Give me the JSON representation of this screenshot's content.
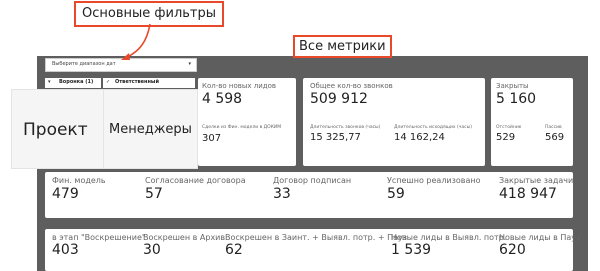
{
  "annotations": {
    "filters_label": "Основные фильтры",
    "metrics_label": "Все метрики",
    "project_label": "Проект",
    "managers_label": "Менеджеры"
  },
  "filters": {
    "date_range_placeholder": "Выберите диапазон дат",
    "funnel_filter": "Воронка (1)",
    "responsible_filter": "Ответственный"
  },
  "metrics": {
    "new_leads": {
      "label": "Кол-во новых лидов",
      "value": "4 598"
    },
    "deals": {
      "label": "Сделки из Фин. модели в ДОКИМ",
      "value": "307"
    },
    "calls": {
      "label": "Общее кол-во звонков",
      "value": "509 912",
      "calls_hours": {
        "label": "Длительность звонков (часы)",
        "value": "15 325,77"
      },
      "outgoing_hours": {
        "label": "Длительность исходящих (часы)",
        "value": "14 162,24"
      }
    },
    "closed": {
      "label": "Закрыты",
      "value": "5 160",
      "refusal": {
        "label": "Отстойник",
        "value": "529"
      },
      "passive": {
        "label": "Пассив",
        "value": "569"
      }
    },
    "row2": [
      {
        "label": "Фин. модель",
        "value": "479"
      },
      {
        "label": "Согласование договора",
        "value": "57"
      },
      {
        "label": "Договор подписан",
        "value": "33"
      },
      {
        "label": "Успешно реализовано",
        "value": "59"
      },
      {
        "label": "Закрытые задачи",
        "value": "418 947"
      }
    ],
    "row3": [
      {
        "label": "в этап \"Воскрешение\"",
        "value": "403"
      },
      {
        "label": "Воскрешен в Архив",
        "value": "30"
      },
      {
        "label": "Воскрешен в Заинт. + Выявл. потр. + Пауз",
        "value": "62"
      },
      {
        "label": "Новые лиды в Выявл. потр.",
        "value": "1 539"
      },
      {
        "label": "Новые лиды в Пауз",
        "value": "620"
      }
    ]
  },
  "colors": {
    "accent": "#e8492b",
    "dashboard_bg": "#5e5e5e"
  },
  "icons": {
    "dropdown": "caret-down-icon",
    "checkmark": "check-icon"
  }
}
